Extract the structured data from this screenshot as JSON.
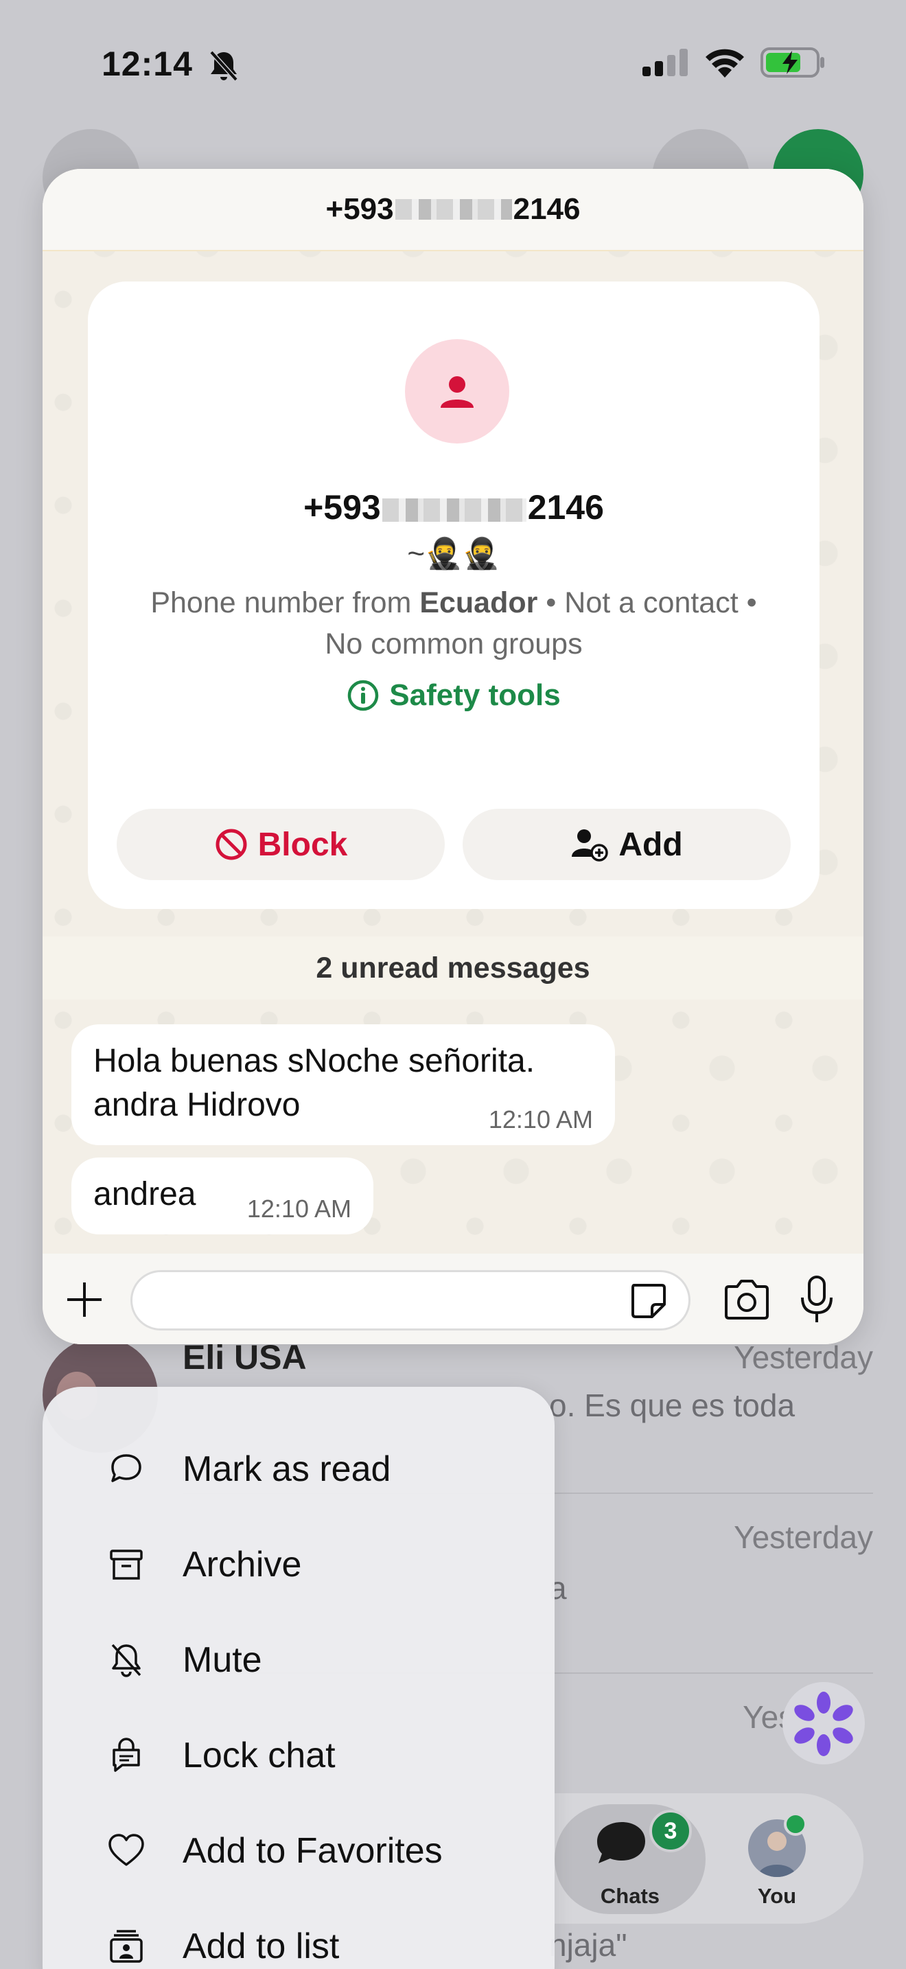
{
  "status_bar": {
    "time": "12:14"
  },
  "chat_preview": {
    "header_title_prefix": "+593",
    "header_title_suffix": "2146",
    "phone_prefix": "+593",
    "phone_suffix": "2146",
    "nickname": "~🥷🥷",
    "desc_prefix": "Phone number from ",
    "desc_country": "Ecuador",
    "desc_suffix": " • Not a contact • No common groups",
    "safety_label": "Safety tools",
    "block_label": "Block",
    "add_label": "Add",
    "unread_label": "2 unread messages",
    "messages": [
      {
        "text_line1": "Hola buenas sNoche señorita.",
        "text_line2": "andra Hidrovo",
        "time": "12:10 AM"
      },
      {
        "text_line1": "andrea",
        "time": "12:10 AM"
      }
    ],
    "input_placeholder": ""
  },
  "background_list": {
    "row1_name": "Eli USA",
    "row1_time": "Yesterday",
    "row1_snippet": "o. Es que es toda",
    "row2_time": "Yesterday",
    "row2_snippet": "a",
    "row3_time": "Yest",
    "row4_snippet": "njaja\""
  },
  "tab_bar": {
    "chats_label": "Chats",
    "chats_badge": "3",
    "you_label": "You"
  },
  "context_menu": {
    "items": [
      {
        "label": "Mark as read",
        "icon": "chat-bubble-icon"
      },
      {
        "label": "Archive",
        "icon": "archive-icon"
      },
      {
        "label": "Mute",
        "icon": "bell-slash-icon"
      },
      {
        "label": "Lock chat",
        "icon": "lock-chat-icon"
      },
      {
        "label": "Add to Favorites",
        "icon": "heart-icon"
      },
      {
        "label": "Add to list",
        "icon": "add-list-icon"
      }
    ]
  },
  "colors": {
    "accent_green": "#1d8a48",
    "block_red": "#d4123a",
    "avatar_pink": "#fbd9df"
  }
}
